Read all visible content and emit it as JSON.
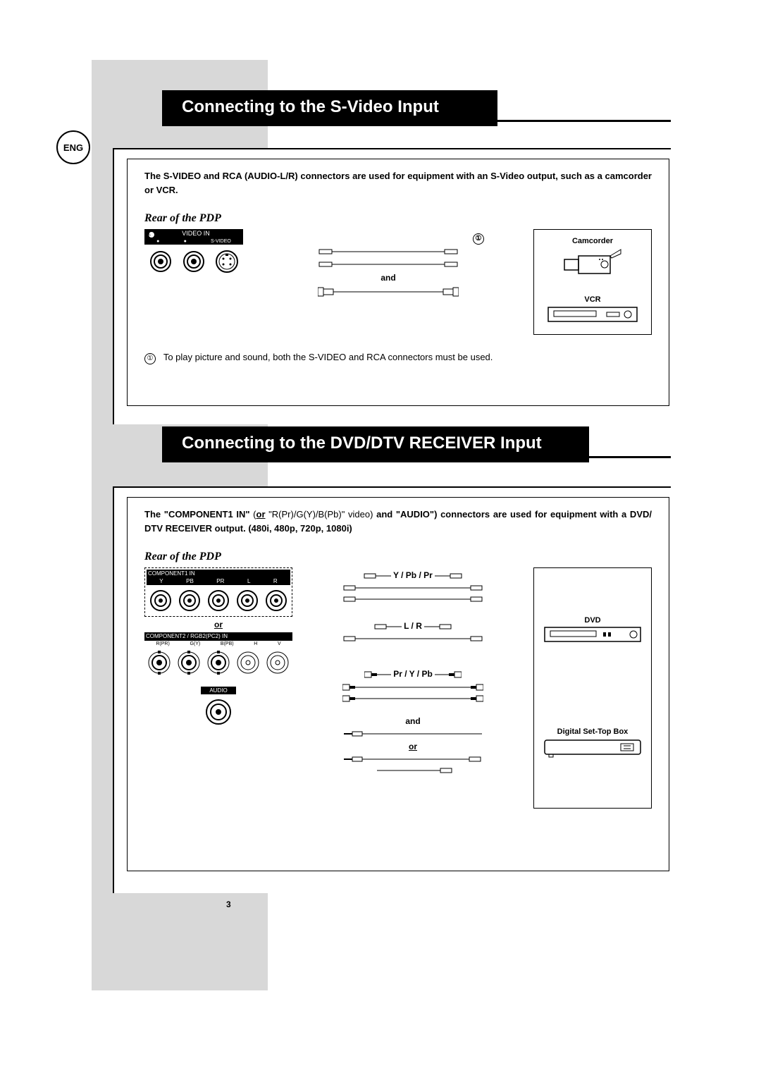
{
  "language_badge": "ENG",
  "page_number": "3",
  "section1": {
    "title": "Connecting to the S-Video Input",
    "intro_bold": "The S-VIDEO and RCA (AUDIO-L/R) connectors are used for equipment with an S-Video output, such as a camcorder or VCR.",
    "rear_label": "Rear of the PDP",
    "panel_header": "VIDEO IN",
    "port_labels": {
      "l": "L",
      "r": "R",
      "sv": "S-VIDEO"
    },
    "cable_marker": "①",
    "cable_word_and": "and",
    "devices": {
      "camcorder": "Camcorder",
      "vcr": "VCR"
    },
    "footnote_marker": "①",
    "footnote_text": "To play picture and sound, both the S-VIDEO and RCA connectors must be used."
  },
  "section2": {
    "title": "Connecting to the DVD/DTV RECEIVER Input",
    "intro_parts": {
      "p1": "The \"COMPONENT1 IN\" ",
      "p2_normal": "(",
      "p3": "or",
      "p4_normal": " \"R(Pr)/G(Y)/B(Pb)\" video) ",
      "p5": "and \"AUDIO\") connectors are used for equipment with a DVD/ DTV RECEIVER output. (480i, 480p, 720p, 1080i)"
    },
    "rear_label": "Rear of the PDP",
    "component1_header": "COMPONENT1 IN",
    "component1_labels": [
      "Y",
      "PB",
      "PR",
      "L",
      "R"
    ],
    "component2_header": "COMPONENT2 / RGB2(PC2) IN",
    "component2_labels": [
      "R(PR)",
      "G(Y)",
      "B(PB)",
      "H",
      "V"
    ],
    "word_or_panel": "or",
    "audio_header": "AUDIO",
    "cable_labels": {
      "ypbpr": "Y / Pb / Pr",
      "lr": "L / R",
      "prypb": "Pr / Y / Pb",
      "and": "and",
      "or": "or"
    },
    "devices": {
      "dvd": "DVD",
      "stb": "Digital Set-Top Box"
    }
  }
}
